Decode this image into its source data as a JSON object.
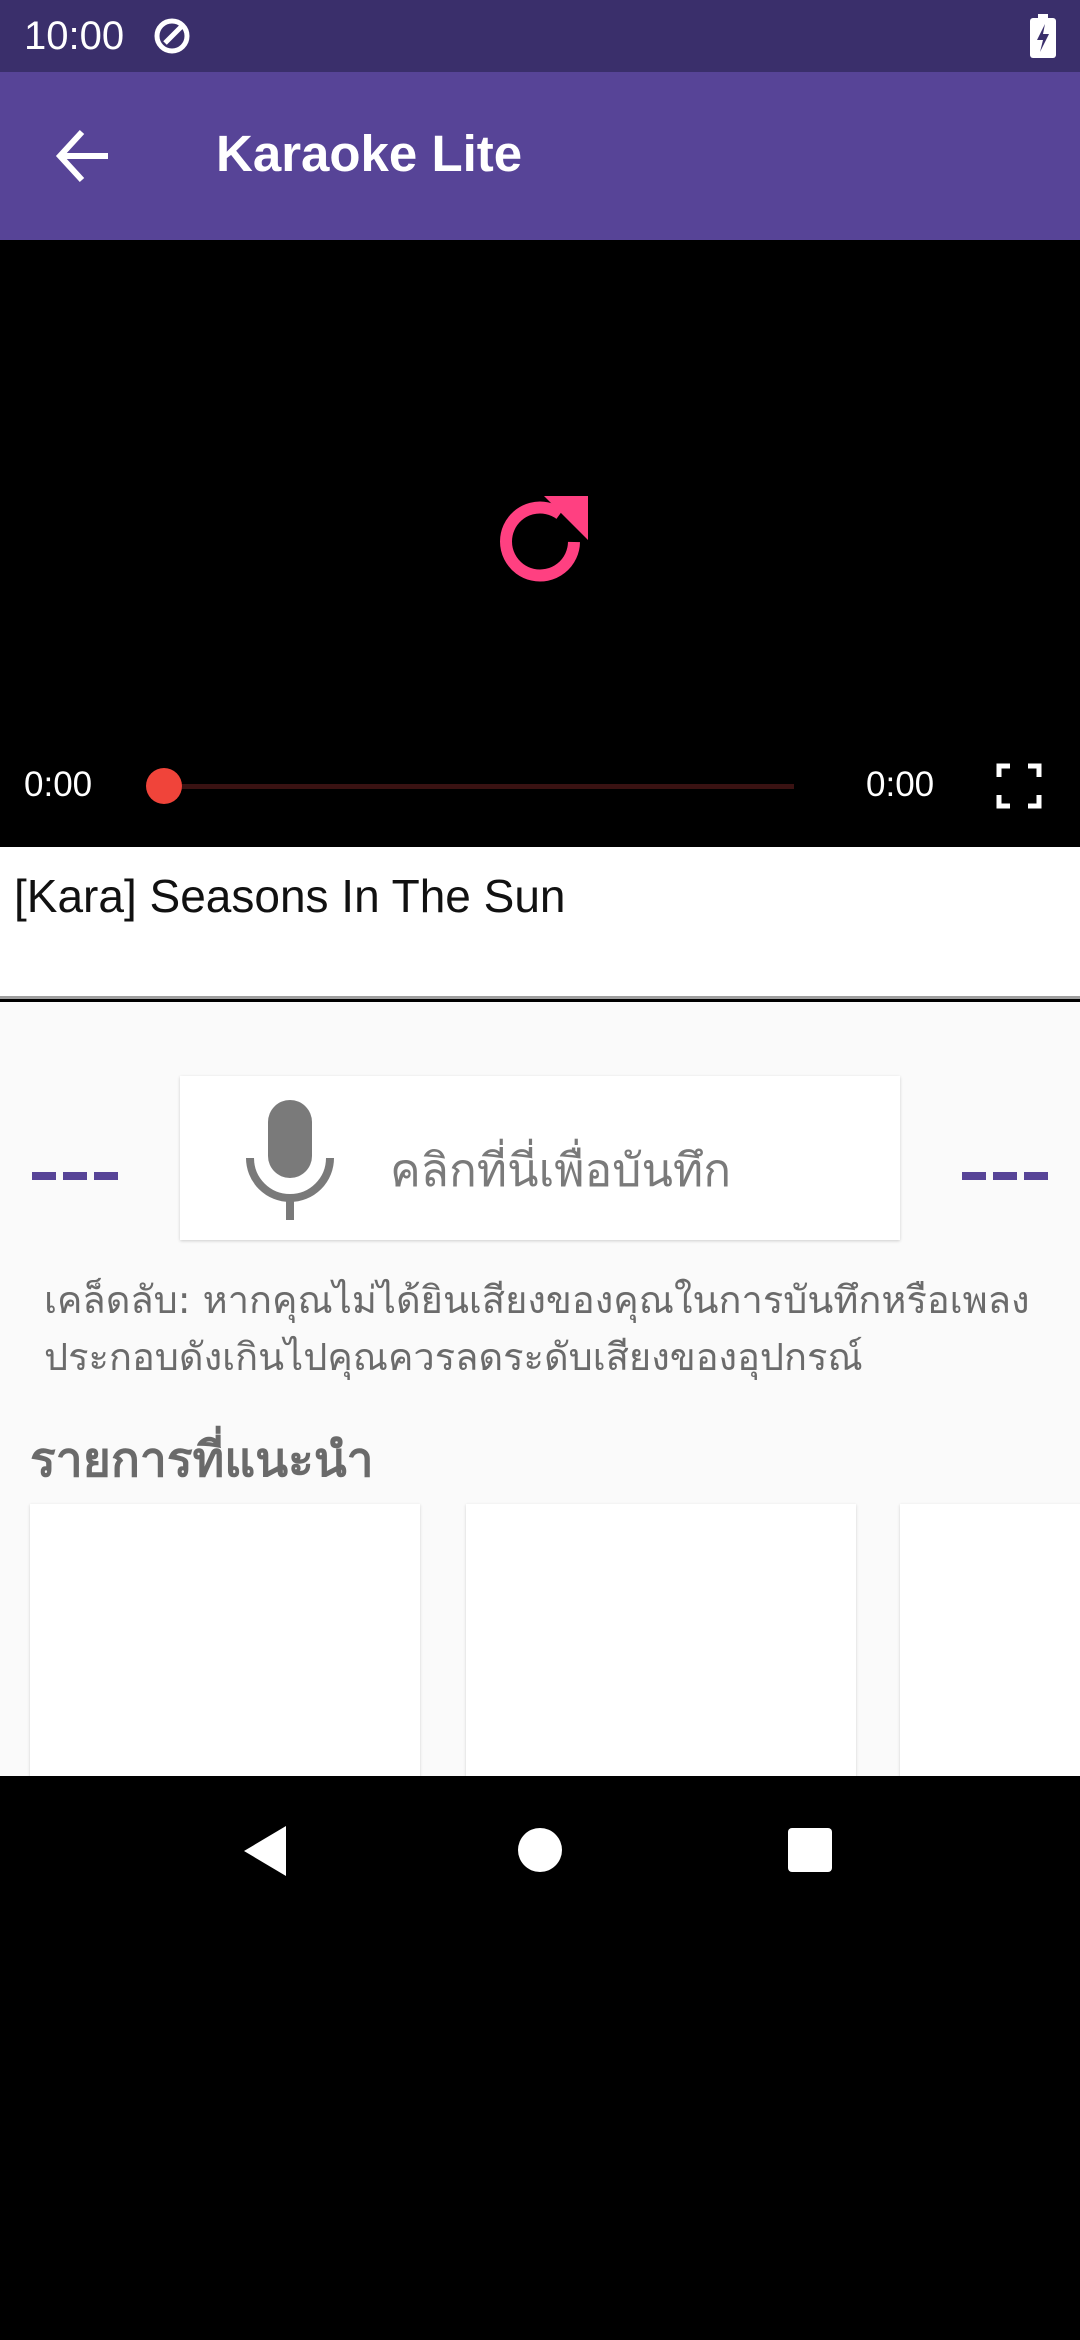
{
  "status_bar": {
    "time": "10:00",
    "icons": [
      "data-saver-icon",
      "battery-charging-icon"
    ]
  },
  "app_bar": {
    "title": "Karaoke Lite",
    "back_icon": "arrow-back-icon"
  },
  "player": {
    "current_time": "0:00",
    "total_time": "0:00",
    "progress": 0,
    "center_icon": "replay-icon",
    "accent_color": "#ff4081",
    "seek_color": "#f0443a"
  },
  "song": {
    "title": "[Kara] Seasons In The Sun"
  },
  "record": {
    "label": "คลิกที่นี่เพื่อบันทึก",
    "icon": "mic-icon",
    "left_indicator": "---",
    "right_indicator": "---"
  },
  "tip": "เคล็ดลับ: หากคุณไม่ได้ยินเสียงของคุณในการบันทึกหรือเพลงประกอบดังเกินไปคุณควรลดระดับเสียงของอุปกรณ์",
  "recommended": {
    "heading": "รายการที่แนะนำ"
  },
  "colors": {
    "status_bar": "#3a2f6b",
    "app_bar": "#574497",
    "content_bg": "#fafafa"
  }
}
